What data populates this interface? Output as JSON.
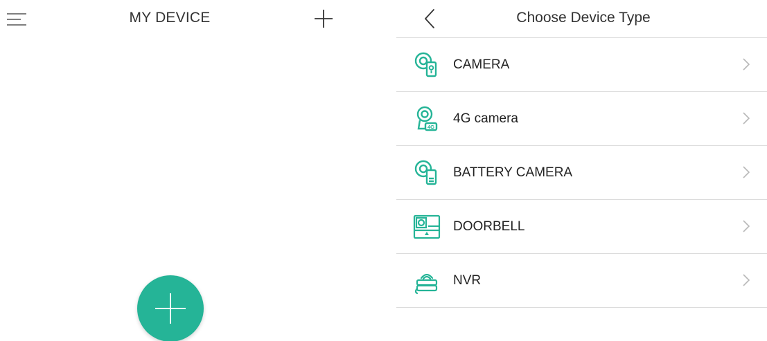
{
  "colors": {
    "accent": "#25b497",
    "divider": "#dcdcdc",
    "chevron": "#b8b8b8"
  },
  "left_screen": {
    "title": "MY DEVICE",
    "menu_icon": "hamburger-menu-icon",
    "add_icon": "plus-icon",
    "fab_icon": "plus-icon"
  },
  "right_screen": {
    "title": "Choose Device Type",
    "back_icon": "chevron-left-icon",
    "devices": [
      {
        "label": "CAMERA",
        "icon": "camera-icon"
      },
      {
        "label": "4G camera",
        "icon": "4g-camera-icon"
      },
      {
        "label": "BATTERY CAMERA",
        "icon": "battery-camera-icon"
      },
      {
        "label": "DOORBELL",
        "icon": "doorbell-icon"
      },
      {
        "label": "NVR",
        "icon": "nvr-icon"
      }
    ]
  }
}
